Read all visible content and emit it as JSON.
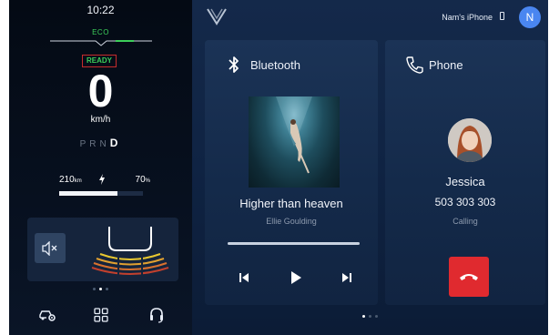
{
  "cluster": {
    "time": "10:22",
    "drive_mode": "ECO",
    "status": "READY",
    "speed": "0",
    "speed_unit": "km/h",
    "gears": [
      "P",
      "R",
      "N"
    ],
    "active_gear": "D",
    "range_value": "210",
    "range_unit": "km",
    "battery_percent_value": "70",
    "battery_percent_unit": "%",
    "battery_level": 0.7,
    "page_indicator": {
      "count": 3,
      "active": 1
    },
    "bottom_icons": [
      "car-settings-icon",
      "apps-grid-icon",
      "headset-icon"
    ],
    "mute_icon": "speaker-mute-icon"
  },
  "header": {
    "logo": "vinfast-logo",
    "device_name": "Nam's iPhone",
    "device_icon": "phone-device-icon",
    "user_initial": "N",
    "avatar_color": "#4a86f0"
  },
  "bluetooth_card": {
    "title": "Bluetooth",
    "icon": "bluetooth-icon",
    "track_title": "Higher than heaven",
    "artist": "Ellie Goulding",
    "progress": 1.0,
    "controls": [
      "previous-track-icon",
      "play-icon",
      "next-track-icon"
    ]
  },
  "phone_card": {
    "title": "Phone",
    "icon": "phone-icon",
    "caller_name": "Jessica",
    "caller_number": "503 303 303",
    "call_status": "Calling",
    "hangup_color": "#e02a2f"
  },
  "main_page_indicator": {
    "count": 3,
    "active": 0
  },
  "colors": {
    "accent_green": "#3ccf5a",
    "ready_border": "#c72c2c",
    "background": "#0a1428"
  }
}
